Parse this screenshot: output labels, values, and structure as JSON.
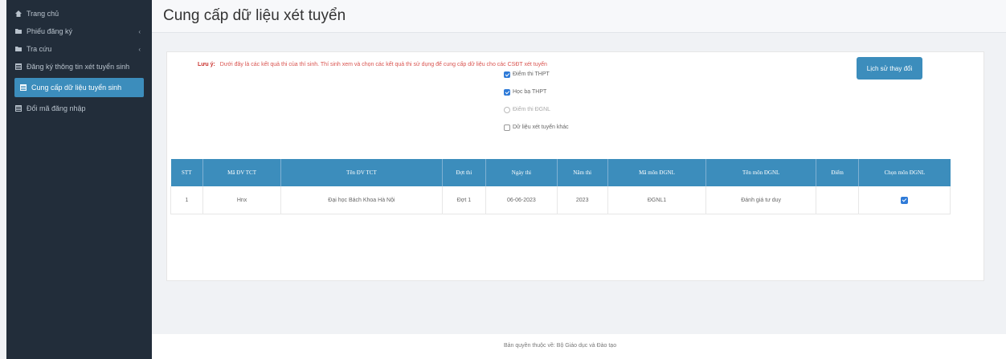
{
  "sidebar": {
    "items": [
      {
        "label": "Trang chủ",
        "icon": "home-icon",
        "caret": ""
      },
      {
        "label": "Phiếu đăng ký",
        "icon": "folder-icon",
        "caret": "‹"
      },
      {
        "label": "Tra cứu",
        "icon": "folder-icon",
        "caret": "‹"
      },
      {
        "label": "Đăng ký thông tin xét tuyển sinh",
        "icon": "table-icon",
        "caret": ""
      },
      {
        "label": "Cung cấp dữ liệu tuyển sinh",
        "icon": "table-icon",
        "caret": "",
        "active": true
      },
      {
        "label": "Đổi mã đăng nhập",
        "icon": "table-icon",
        "caret": ""
      }
    ]
  },
  "page": {
    "title": "Cung cấp dữ liệu xét tuyển"
  },
  "notice": {
    "prefix": "Lưu ý:",
    "text": "Dưới đây là các kết quả thi của thí sinh. Thí sinh xem và chọn các kết quả thi sử dụng để cung cấp dữ liệu cho các CSĐT xét tuyển"
  },
  "buttons": {
    "history": "Lịch sử thay đổi"
  },
  "filters": [
    {
      "label": "Điểm thi THPT",
      "state": "checked"
    },
    {
      "label": "Học bạ THPT",
      "state": "checked"
    },
    {
      "label": "Điểm thi ĐGNL",
      "state": "disabled"
    },
    {
      "label": "Dữ liệu xét tuyển khác",
      "state": "unchecked"
    }
  ],
  "table": {
    "headers": [
      "STT",
      "Mã ĐV TCT",
      "Tên ĐV TCT",
      "Đợt thi",
      "Ngày thi",
      "Năm thi",
      "Mã môn ĐGNL",
      "Tên môn ĐGNL",
      "Điểm",
      "Chọn môn ĐGNL"
    ],
    "rows": [
      [
        "1",
        "Hnx",
        "Đại học Bách Khoa Hà Nội",
        "Đợt 1",
        "06-06-2023",
        "2023",
        "ĐGNL1",
        "Đánh giá tư duy",
        "",
        "checked"
      ]
    ]
  },
  "footer": {
    "text": "Bản quyền thuộc về: Bộ Giáo dục và Đào tạo"
  },
  "colors": {
    "sidebar_bg": "#222d3a",
    "accent": "#3c8dbc",
    "notice": "#d9534f"
  }
}
